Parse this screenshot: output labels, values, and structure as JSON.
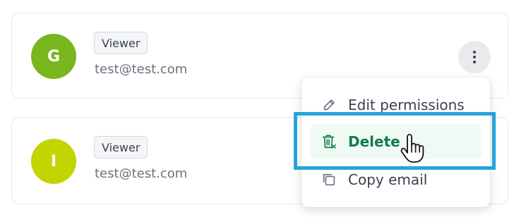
{
  "members": [
    {
      "initial": "G",
      "avatar_color": "#79b61e",
      "role": "Viewer",
      "email": "test@test.com"
    },
    {
      "initial": "I",
      "avatar_color": "#c3d400",
      "role": "Viewer",
      "email": "test@test.com"
    }
  ],
  "menu": {
    "items": [
      {
        "label": "Edit permissions",
        "icon": "pencil-icon"
      },
      {
        "label": "Delete",
        "icon": "trash-icon"
      },
      {
        "label": "Copy email",
        "icon": "copy-icon"
      }
    ]
  },
  "colors": {
    "delete_text": "#137a4c",
    "delete_bg": "#effaf5",
    "highlight_border": "#27a3dc"
  }
}
